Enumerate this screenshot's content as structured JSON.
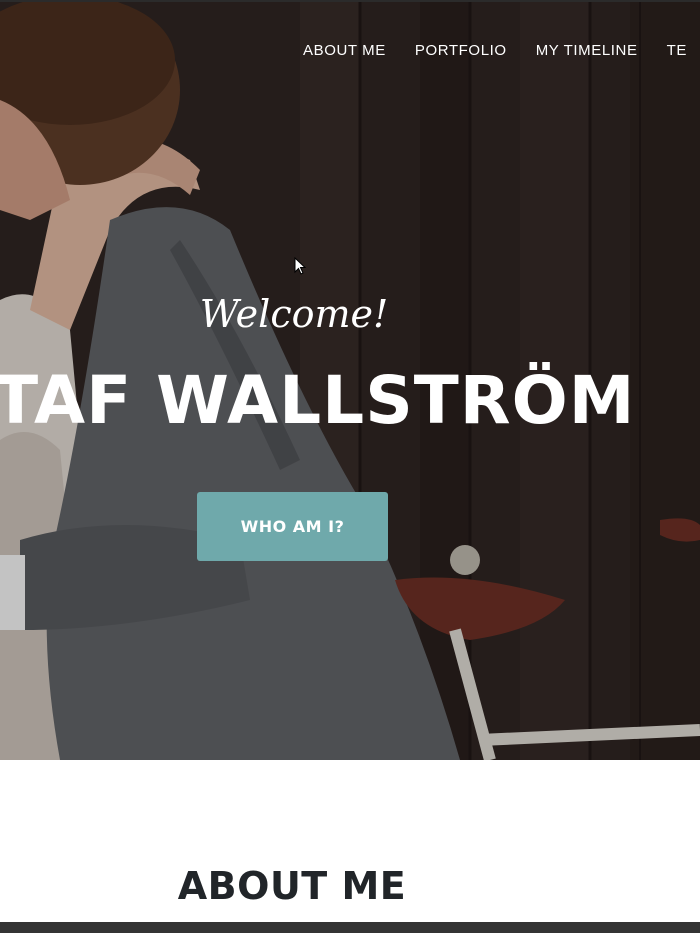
{
  "nav": {
    "items": [
      {
        "label": "ABOUT ME"
      },
      {
        "label": "PORTFOLIO"
      },
      {
        "label": "MY TIMELINE"
      },
      {
        "label": "TE"
      }
    ]
  },
  "hero": {
    "welcome": "Welcome!",
    "name": "STAF WALLSTRÖM",
    "cta_label": "WHO AM I?"
  },
  "about": {
    "title": "ABOUT ME"
  },
  "colors": {
    "accent": "#6fa9ab",
    "heading": "#212529",
    "hero_text": "#ffffff"
  }
}
